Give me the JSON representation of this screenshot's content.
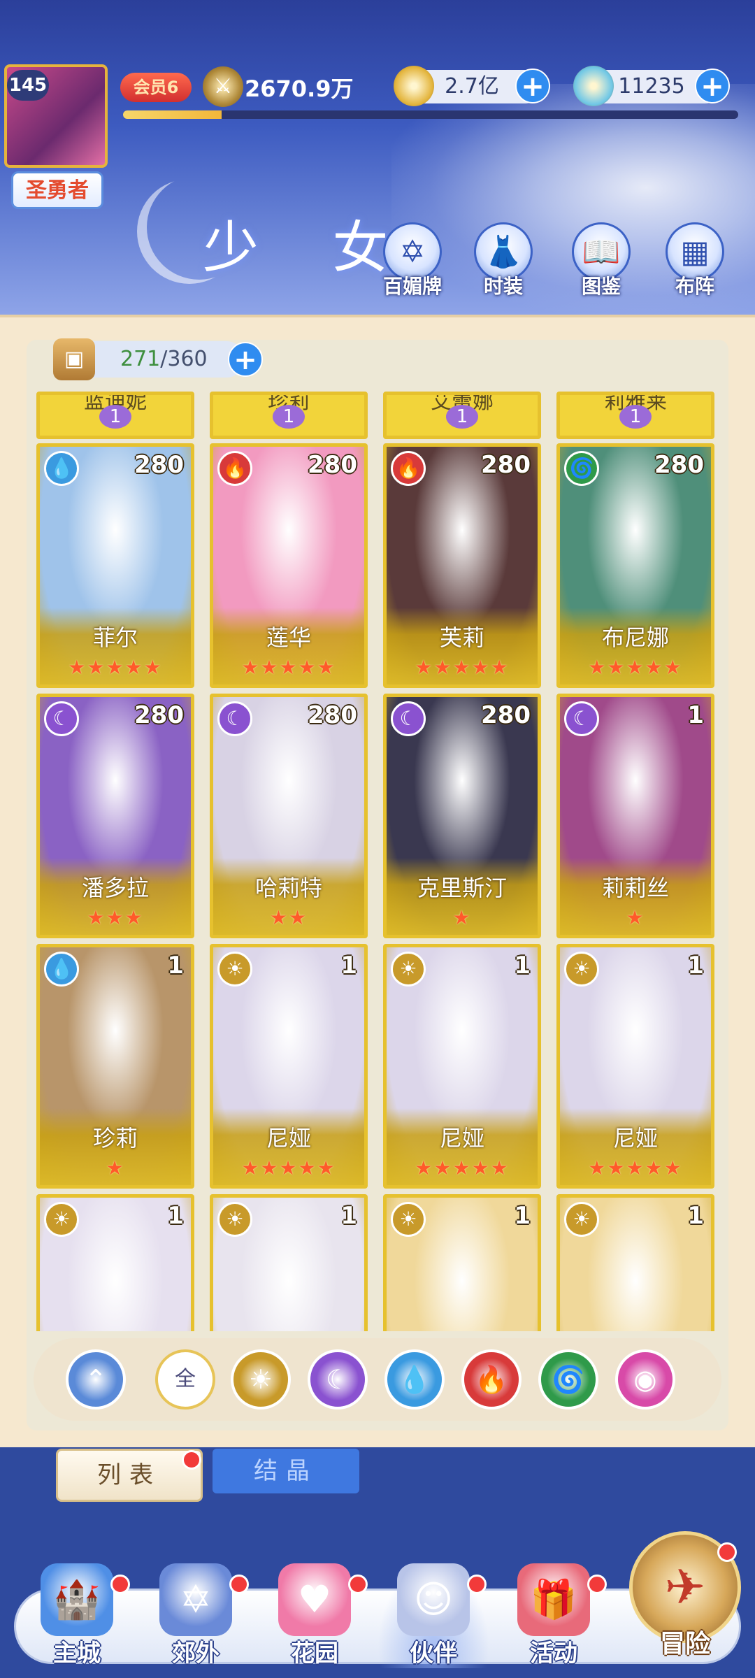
{
  "player": {
    "level": "145",
    "title": "圣勇者",
    "vip": "会员6",
    "power": "2670.9万",
    "xp_progress": 0.16
  },
  "currencies": [
    {
      "value": "2.7亿",
      "icon": "gold-coin-icon",
      "color": "#e3b43c"
    },
    {
      "value": "11235",
      "icon": "diamond-icon",
      "color": "#6fc7e6"
    }
  ],
  "page": {
    "title": "少 女",
    "nav": [
      {
        "label": "百媚牌",
        "icon": "card-icon",
        "glyph": "✡"
      },
      {
        "label": "时装",
        "icon": "outfit-icon",
        "glyph": "👗"
      },
      {
        "label": "图鉴",
        "icon": "book-icon",
        "glyph": "📖"
      },
      {
        "label": "布阵",
        "icon": "formation-grid-icon",
        "glyph": "▦"
      }
    ]
  },
  "roster": {
    "capacity_current": "271",
    "capacity_max": "/360",
    "top_row": [
      {
        "name": "蓝迪妮",
        "stars": "1"
      },
      {
        "name": "珍莉",
        "stars": "1"
      },
      {
        "name": "艾蕾娜",
        "stars": "1"
      },
      {
        "name": "莉雅莱",
        "stars": "1"
      }
    ],
    "cards": [
      {
        "name": "菲尔",
        "level": "280",
        "element": "water",
        "stars": 5,
        "art": "#9fc3ea"
      },
      {
        "name": "莲华",
        "level": "280",
        "element": "fire",
        "stars": 5,
        "art": "#f29ac0"
      },
      {
        "name": "芙莉",
        "level": "280",
        "element": "fire",
        "stars": 5,
        "art": "#5a3a3a"
      },
      {
        "name": "布尼娜",
        "level": "280",
        "element": "wind",
        "stars": 5,
        "art": "#4f8f7a"
      },
      {
        "name": "潘多拉",
        "level": "280",
        "element": "moon",
        "stars": 3,
        "art": "#8a62c4"
      },
      {
        "name": "哈莉特",
        "level": "280",
        "element": "moon",
        "stars": 2,
        "art": "#d8d2e4"
      },
      {
        "name": "克里斯汀",
        "level": "280",
        "element": "moon",
        "stars": 1,
        "art": "#3a3850"
      },
      {
        "name": "莉莉丝",
        "level": "1",
        "element": "moon",
        "stars": 1,
        "art": "#a04a8a"
      },
      {
        "name": "珍莉",
        "level": "1",
        "element": "water",
        "stars": 1,
        "art": "#b8956a"
      },
      {
        "name": "尼娅",
        "level": "1",
        "element": "light",
        "stars": 5,
        "art": "#dcd6ea"
      },
      {
        "name": "尼娅",
        "level": "1",
        "element": "light",
        "stars": 5,
        "art": "#dcd6ea"
      },
      {
        "name": "尼娅",
        "level": "1",
        "element": "light",
        "stars": 5,
        "art": "#dcd6ea"
      },
      {
        "name": "",
        "level": "1",
        "element": "light",
        "stars": 0,
        "art": "#e6e0ef"
      },
      {
        "name": "",
        "level": "1",
        "element": "light",
        "stars": 0,
        "art": "#e8e4ee"
      },
      {
        "name": "",
        "level": "1",
        "element": "light",
        "stars": 0,
        "art": "#f0d89a"
      },
      {
        "name": "",
        "level": "1",
        "element": "light",
        "stars": 0,
        "art": "#f0d89a"
      }
    ]
  },
  "elements": {
    "water": {
      "color": "#3a9ae0",
      "glyph": "💧"
    },
    "fire": {
      "color": "#d83a3a",
      "glyph": "🔥"
    },
    "wind": {
      "color": "#2f9a4a",
      "glyph": "🌀"
    },
    "moon": {
      "color": "#8a52d0",
      "glyph": "☾"
    },
    "light": {
      "color": "#c89a2a",
      "glyph": "☀"
    }
  },
  "filters": [
    {
      "id": "collapse",
      "icon": "collapse-arrow-icon",
      "glyph": "⌃",
      "color": "#5a8ad8"
    },
    {
      "id": "all",
      "label": "全",
      "icon": "all-icon"
    },
    {
      "id": "light",
      "icon": "sun-icon",
      "glyph": "☀",
      "color": "#c89a2a"
    },
    {
      "id": "moon",
      "icon": "moon-icon",
      "glyph": "☾",
      "color": "#8a52d0"
    },
    {
      "id": "water",
      "icon": "water-drop-icon",
      "glyph": "💧",
      "color": "#3a9ae0"
    },
    {
      "id": "fire",
      "icon": "fire-icon",
      "glyph": "🔥",
      "color": "#d83a3a"
    },
    {
      "id": "wind",
      "icon": "wind-icon",
      "glyph": "🌀",
      "color": "#2f9a4a"
    },
    {
      "id": "star",
      "icon": "star-orb-icon",
      "glyph": "◉",
      "color": "#d84aa8"
    }
  ],
  "subtabs": {
    "list": "列表",
    "crystal": "结晶"
  },
  "bottom_nav": [
    {
      "label": "主城",
      "icon": "castle-icon",
      "glyph": "🏰",
      "color": "#4f8fe6"
    },
    {
      "label": "郊外",
      "icon": "portal-icon",
      "glyph": "✡",
      "color": "#6a8ad8"
    },
    {
      "label": "花园",
      "icon": "heart-garden-icon",
      "glyph": "♥",
      "color": "#f07aa8"
    },
    {
      "label": "伙伴",
      "icon": "partner-icon",
      "glyph": "☺",
      "color": "#b8c4e8"
    },
    {
      "label": "活动",
      "icon": "gift-box-icon",
      "glyph": "🎁",
      "color": "#e86a7a"
    }
  ],
  "adventure": {
    "label": "冒险",
    "icon": "compass-icon",
    "glyph": "✈"
  }
}
